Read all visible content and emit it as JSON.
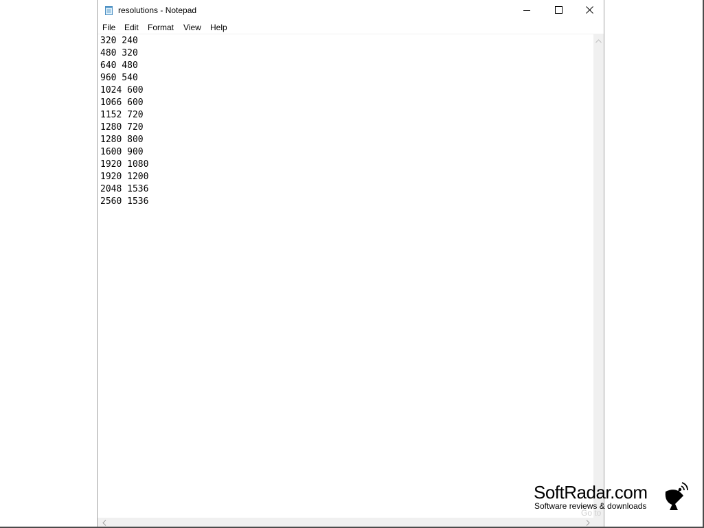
{
  "window": {
    "title": "resolutions - Notepad",
    "app_icon": "notepad-icon",
    "controls": {
      "minimize_icon": "minimize-icon",
      "maximize_icon": "maximize-icon",
      "close_icon": "close-icon"
    }
  },
  "menu": {
    "items": [
      {
        "label": "File"
      },
      {
        "label": "Edit"
      },
      {
        "label": "Format"
      },
      {
        "label": "View"
      },
      {
        "label": "Help"
      }
    ]
  },
  "document": {
    "lines": [
      "320 240",
      "480 320",
      "640 480",
      "960 540",
      "1024 600",
      "1066 600",
      "1152 720",
      "1280 720",
      "1280 800",
      "1600 900",
      "1920 1080",
      "1920 1200",
      "2048 1536",
      "2560 1536"
    ]
  },
  "overlay": {
    "faint_text": "Go to",
    "brand": "SoftRadar.com",
    "tagline": "Software reviews & downloads",
    "brand_icon": "satellite-dish-icon"
  },
  "colors": {
    "window_border": "#a0a0a0",
    "scrollbar_bg": "#f0f0f0",
    "text": "#000000",
    "faint_text": "#d0d0d0"
  }
}
